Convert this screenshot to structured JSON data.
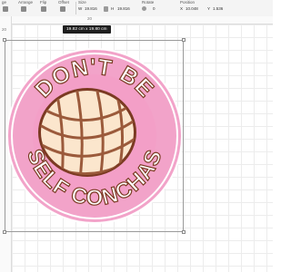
{
  "toolbar": {
    "size_label": "Size",
    "width_prefix": "W",
    "width_value": "19.816",
    "height_prefix": "H",
    "height_value": "19.816",
    "rotate_label": "Rotate",
    "rotate_value": "0",
    "position_label": "Position",
    "x_prefix": "X",
    "x_value": "10.048",
    "y_prefix": "Y",
    "y_value": "1.536",
    "arrange_label": "Arrange",
    "flip_label": "Flip",
    "offset_label": "Offset",
    "first_label": "ge"
  },
  "ruler": {
    "top_number": "20",
    "left_number": "20"
  },
  "selection": {
    "dimension_tip": "19.82  cm x 19.80  cm"
  },
  "design": {
    "top_text": "DON'T BE",
    "bottom_text": "SELF CONCHAS",
    "colors": {
      "outer_ring": "#f2a3c9",
      "inner_pink": "#f39fc7",
      "border": "#7b3a22",
      "concha_topping": "#fbe6cd",
      "concha_lines": "#9b5a3b",
      "text_fill": "#ffffff"
    }
  }
}
